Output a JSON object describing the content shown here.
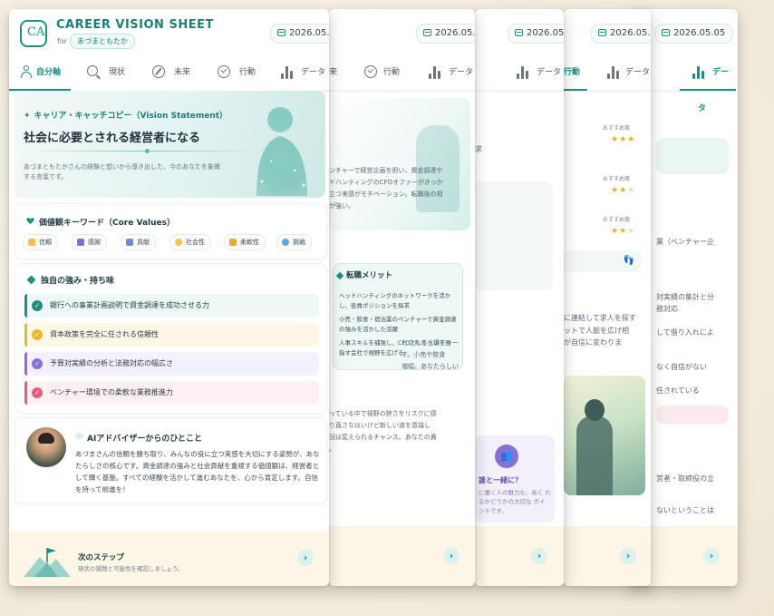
{
  "app": {
    "title": "CAREER VISION SHEET",
    "for_label": "for",
    "user_name": "あづまともたか",
    "date": "2026.05.05"
  },
  "tabs": [
    {
      "label": "自分軸"
    },
    {
      "label": "現状"
    },
    {
      "label": "未来"
    },
    {
      "label": "行動"
    },
    {
      "label": "データ"
    }
  ],
  "vision": {
    "heading": "キャリア・キャッチコピー（Vision Statement）",
    "statement": "社会に必要とされる経営者になる",
    "description": "あづまともたかさんの経験と想いから導き出した、今のあなたを象徴する言葉です。"
  },
  "values": {
    "heading": "価値観キーワード（Core Values）",
    "chips": [
      {
        "label": "信頼",
        "color": "#f2c24b"
      },
      {
        "label": "感謝",
        "color": "#7c6fd6"
      },
      {
        "label": "貢献",
        "color": "#6b8fd6"
      },
      {
        "label": "社会性",
        "color": "#f2c24b"
      },
      {
        "label": "柔軟性",
        "color": "#e7a93a"
      },
      {
        "label": "挑戦",
        "color": "#5fa8d8"
      }
    ]
  },
  "strengths": {
    "heading": "独自の強み・持ち味",
    "items": [
      {
        "label": "銀行への事業計画説明で資金調達を成功させる力",
        "color": "#1f8f84",
        "bg": "#eef8f6"
      },
      {
        "label": "資本政策を完全に任される信頼性",
        "color": "#e9b830",
        "bg": "#fdf7e6"
      },
      {
        "label": "予算対実績の分析と法務対応の幅広さ",
        "color": "#8a6fd6",
        "bg": "#f4f1fb"
      },
      {
        "label": "ベンチャー環境での柔軟な業務推進力",
        "color": "#e0607a",
        "bg": "#fcf0f2"
      }
    ]
  },
  "advice": {
    "heading": "AIアドバイザーからのひとこと",
    "body": "あづまさんの信頼を勝ち取り、みんなの役に立つ実感を大切にする姿勢が、あなたらしさの核心です。資金調達の強みと社会貢献を重視する価値観は、経営者として輝く基盤。すべての経験を活かして進むあなたを、心から肯定します。自信を持って前進を！"
  },
  "next_step": {
    "title": "次のステップ",
    "subtitle": "現状の課題と可能性を確認しましょう。"
  },
  "card2": {
    "tab_fragment": "来",
    "text_lines": [
      "ンチャーで経営企画を担い、資金調達や",
      "ドハンティングのCFOオファーがきっか",
      "立つ実感がモチベーション。転職後の相",
      "が強い。"
    ],
    "merit_heading": "転職メリット",
    "merit_items": [
      "ヘッドハンティングのネットワークを活かし、役員ポジションを探求",
      "小売・飲食・宿泊業のベンチャーで資金調達の強みを活かした活躍",
      "人事スキルを補強し、CFOとして上場を目指す会社で視野を広げる"
    ],
    "future_lines": [
      "とされるベンチャー",
      "す。小売や飲食",
      "増幅。あなたらしい"
    ],
    "risk_lines": [
      "っている中で視野の狭さをリスクに感",
      "り直さなはいけど新しい道を意識し",
      "況は変えられるチャンス。あなたの責",
      "。"
    ]
  },
  "card3": {
    "side_label": "求",
    "together_title": "誰と一緒に？",
    "together_body": "に働く人の魅力も、長く れるかどうかの大切な ポイントです。"
  },
  "card4": {
    "recommend_label": "おすすめ度",
    "ratings": [
      3,
      2,
      2
    ],
    "lines": [
      "に連結して求人を探す",
      "ットで人脈を広げ相",
      "が自信に変わりま"
    ]
  },
  "card5": {
    "lines": [
      "業（ベンチャー企",
      "対実績の集計と分",
      "務対応",
      "して借り入れによ",
      "なく自信がない",
      "任されている",
      "営者・取締役の立",
      "ないということは"
    ]
  }
}
